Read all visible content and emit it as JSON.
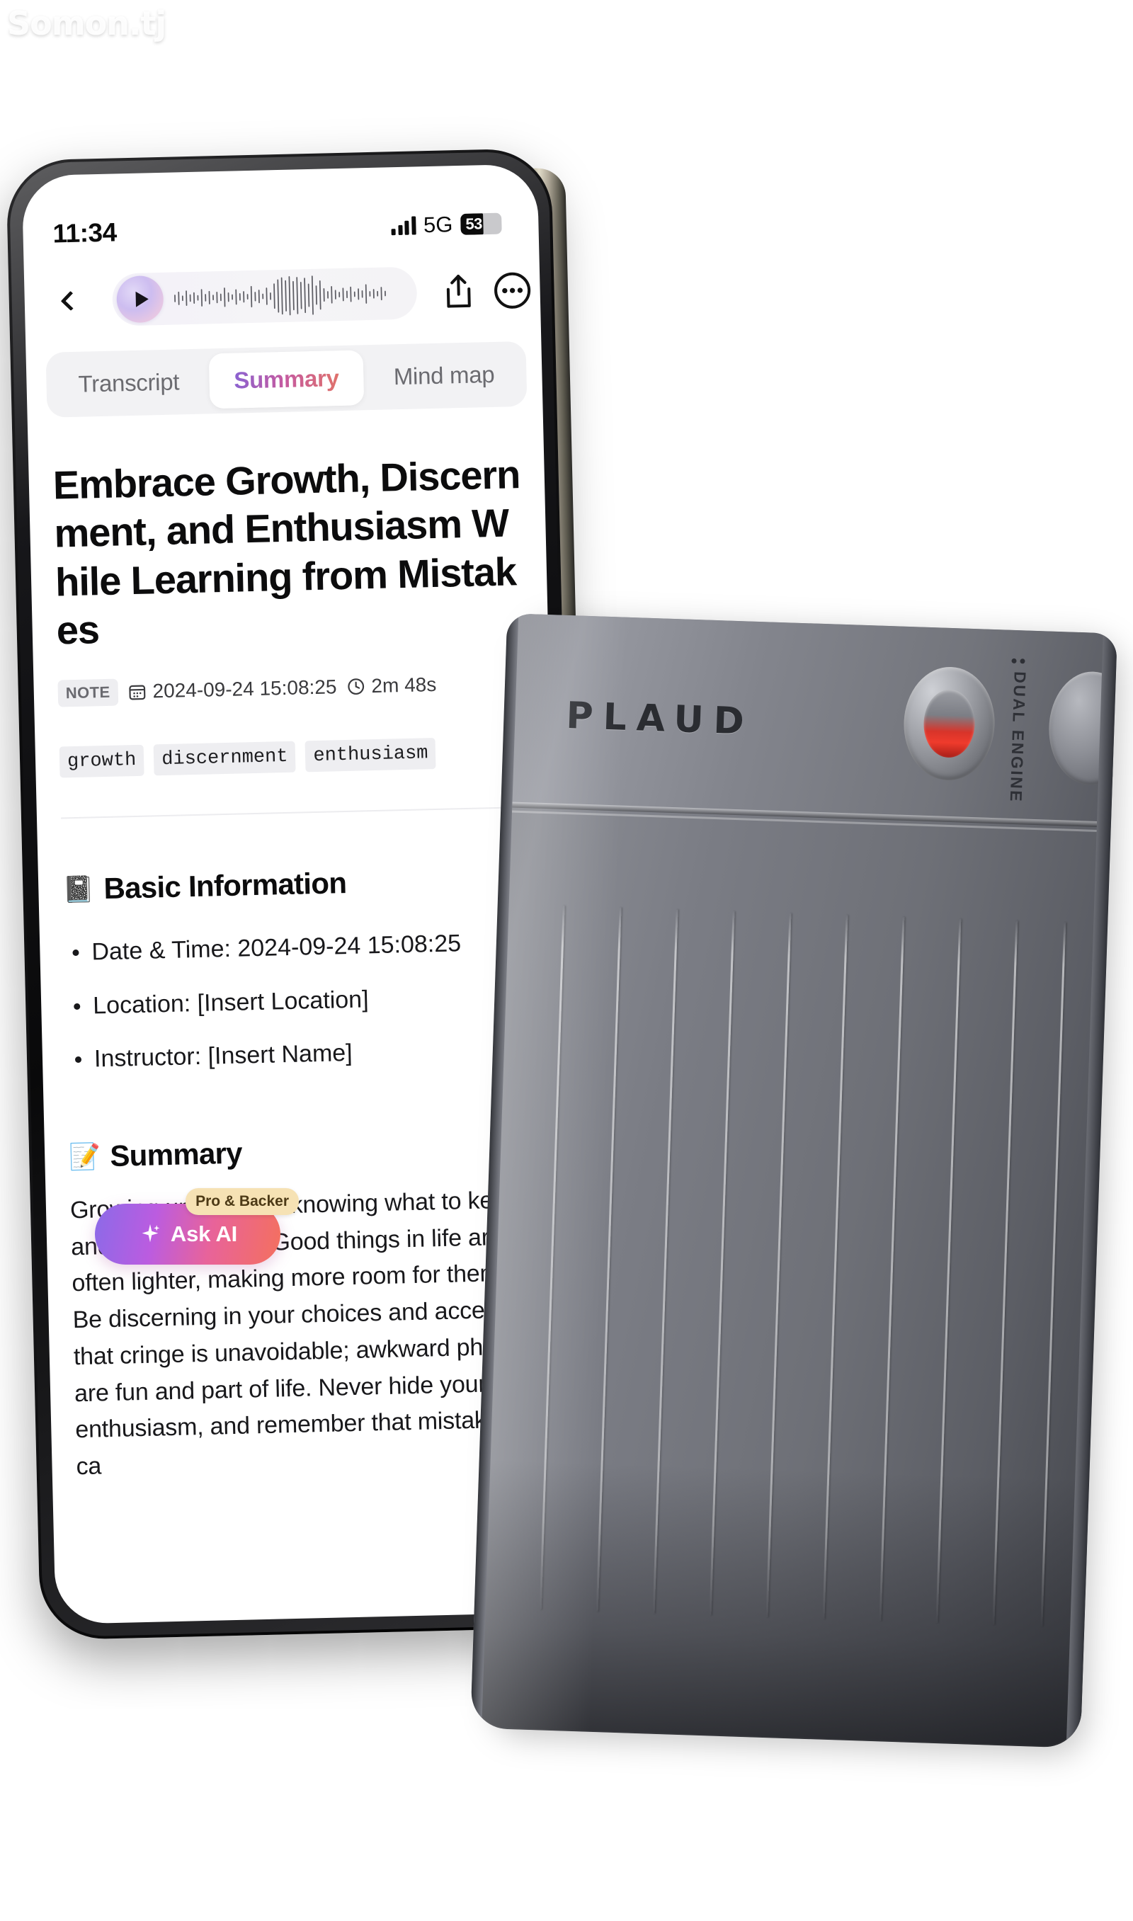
{
  "watermark": "Somon.tj",
  "status_bar": {
    "time": "11:34",
    "network": "5G",
    "battery_percent": "53",
    "signal_icon": "signal-bars-icon"
  },
  "appbar": {
    "back_icon": "chevron-left-icon",
    "play_icon": "play-icon",
    "waveform_icon": "audio-waveform-icon",
    "share_icon": "share-icon",
    "more_icon": "more-ellipsis-icon"
  },
  "tabs": [
    {
      "label": "Transcript",
      "active": false
    },
    {
      "label": "Summary",
      "active": true
    },
    {
      "label": "Mind map",
      "active": false
    }
  ],
  "note": {
    "title": "Embrace Growth, Discernment, and Enthusiasm While Learning from Mistakes",
    "type_badge": "NOTE",
    "date_icon": "calendar-icon",
    "date": "2024-09-24 15:08:25",
    "duration_icon": "clock-icon",
    "duration": "2m 48s",
    "tags": [
      "growth",
      "discernment",
      "enthusiasm"
    ]
  },
  "sections": [
    {
      "emoji": "📓",
      "emoji_name": "notebook-icon",
      "heading": "Basic Information",
      "bullets": [
        "Date & Time: 2024-09-24 15:08:25",
        "Location: [Insert Location]",
        "Instructor: [Insert Name]"
      ]
    },
    {
      "emoji": "📝",
      "emoji_name": "memo-pencil-icon",
      "heading": "Summary",
      "paragraph": "Growing up involves knowing what to keep and what to let go. Good things in life are often lighter, making more room for them. Be discerning in your choices and accept that cringe is unavoidable; awkward phases are fun and part of life. Never hide your enthusiasm, and remember that mistakes ca"
    }
  ],
  "ask_ai": {
    "label": "Ask AI",
    "badge": "Pro & Backer",
    "sparkle_icon": "sparkle-icon"
  },
  "device": {
    "brand": "PLAUD",
    "dual_engine_line1": "DUAL",
    "dual_engine_line2": "ENGINE",
    "record_button_icon": "record-button-icon",
    "speaker_icon": "speaker-grille-icon"
  },
  "colors": {
    "accent_purple": "#8b6ae8",
    "accent_pink": "#e8639a",
    "accent_orange": "#f4705e",
    "badge_gold": "#f6e2b4",
    "record_red": "#ef3b2c",
    "device_gray": "#7b7d85"
  }
}
